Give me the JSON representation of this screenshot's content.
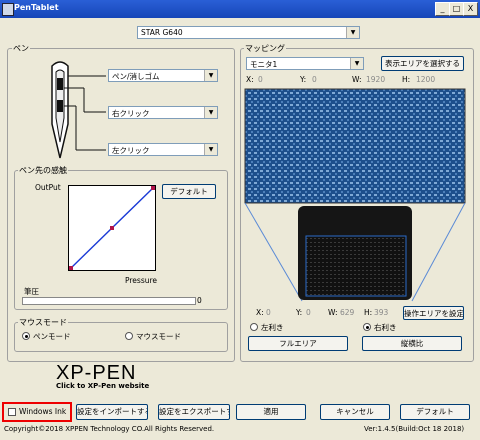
{
  "window": {
    "title": "PenTablet",
    "min_btn": "_",
    "max_btn": "□",
    "close_btn": "X"
  },
  "device_select": {
    "value": "STAR G640"
  },
  "pen": {
    "group_label": "ペン",
    "upper_button": "ペン/消しゴム",
    "middle_button": "右クリック",
    "lower_button": "左クリック"
  },
  "pressure": {
    "group_label": "ペン先の感触",
    "output_label": "OutPut",
    "pressure_label": "Pressure",
    "default_button": "デフォルト",
    "pen_pressure_label": "筆圧",
    "pen_pressure_value": "0",
    "curve_color": "#1a3ad6",
    "point_color": "#b0144a"
  },
  "mouse_mode": {
    "group_label": "マウスモード",
    "pen_mode": "ペンモード",
    "mouse_mode": "マウスモード",
    "selected": "pen"
  },
  "mapping": {
    "group_label": "マッピング",
    "monitor_select": "モニタ1",
    "select_display_area_button": "表示エリアを選択する",
    "display": {
      "x_label": "X:",
      "x": "0",
      "y_label": "Y:",
      "y": "0",
      "w_label": "W:",
      "w": "1920",
      "h_label": "H:",
      "h": "1200"
    },
    "tablet": {
      "x_label": "X:",
      "x": "0",
      "y_label": "Y:",
      "y": "0",
      "w_label": "W:",
      "w": "629",
      "h_label": "H:",
      "h": "393"
    },
    "operation_area_button": "操作エリアを設定",
    "left_hand": "左利き",
    "right_hand": "右利き",
    "selected_hand": "right",
    "full_area_button": "フルエリア",
    "aspect_ratio_button": "縦横比"
  },
  "brand": {
    "logo": "XP-PEN",
    "link": "Click to XP-Pen website"
  },
  "bottom": {
    "windows_ink": "Windows Ink",
    "import_button": "設定をインポートする",
    "export_button": "設定をエクスポートする",
    "apply_button": "適用",
    "cancel_button": "キャンセル",
    "default_button": "デフォルト",
    "copyright": "Copyright©2018  XPPEN Technology CO.All Rights Reserved.",
    "version": "Ver:1.4.5(Build:Oct 18 2018)"
  }
}
